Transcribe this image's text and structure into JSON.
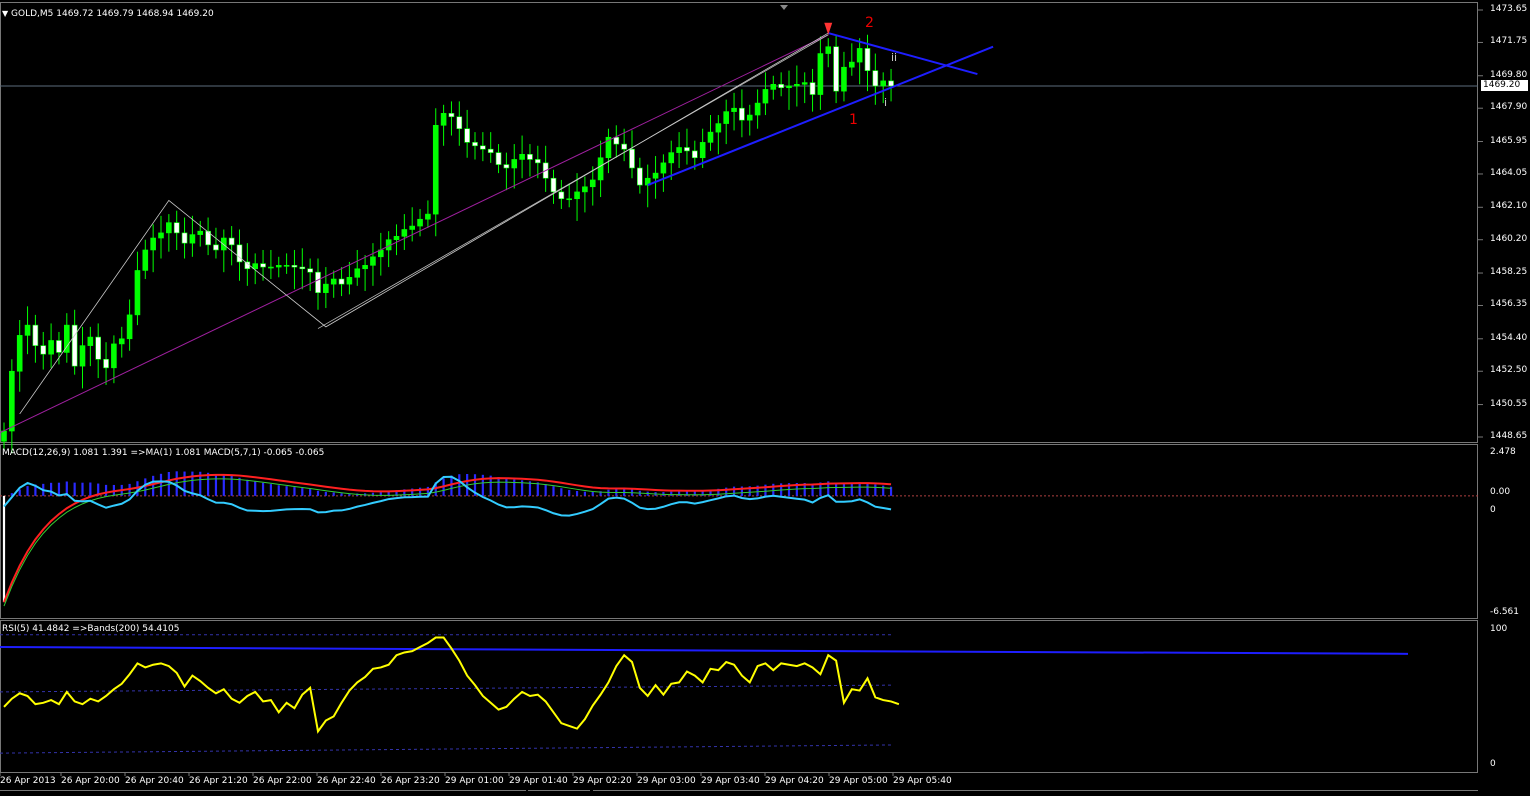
{
  "window": {
    "title": "GOLD,M5  1469.72 1469.79 1468.94 1469.20",
    "menu_arrow_icon": "triangle-down-icon"
  },
  "main_chart": {
    "current_price": "1469.20",
    "price_ticks": [
      "1473.65",
      "1471.75",
      "1469.80",
      "1467.90",
      "1465.95",
      "1464.05",
      "1462.10",
      "1460.20",
      "1458.25",
      "1456.35",
      "1454.40",
      "1452.50",
      "1450.55",
      "1448.65"
    ],
    "wave_labels": {
      "w1": "1",
      "w2": "2",
      "wi": "i",
      "wii": "ii"
    }
  },
  "macd": {
    "title": "MACD(12,26,9) 1.081 1.391  =>MA(1) 1.081  MACD(5,7,1) -0.065 -0.065",
    "ticks": {
      "top": "2.478",
      "zero_left": "0.00",
      "zero_right": "0",
      "bottom": "-6.561"
    }
  },
  "rsi": {
    "title": "RSI(5) 41.4842  =>Bands(200) 54.4105",
    "ticks": {
      "top": "100",
      "bottom": "0"
    }
  },
  "time_axis": [
    "26 Apr 2013",
    "26 Apr 20:00",
    "26 Apr 20:40",
    "26 Apr 21:20",
    "26 Apr 22:00",
    "26 Apr 22:40",
    "26 Apr 23:20",
    "29 Apr 01:00",
    "29 Apr 01:40",
    "29 Apr 02:20",
    "29 Apr 03:00",
    "29 Apr 03:40",
    "29 Apr 04:20",
    "29 Apr 05:00",
    "29 Apr 05:40"
  ],
  "colors": {
    "bull_candle": "#00ff00",
    "bear_candle": "#ffffff",
    "trendline": "#1e1eff",
    "channel_magenta": "#a020a0",
    "macd_signal": "#ff2020",
    "macd_fast": "#33ccff",
    "rsi_line": "#ffff00",
    "wave_label": "#ee1111"
  },
  "chart_data": {
    "type": "candlestick",
    "symbol": "GOLD",
    "timeframe": "M5",
    "ylim": [
      1448.65,
      1473.65
    ],
    "closes": [
      1449.0,
      1452.5,
      1454.6,
      1455.2,
      1454.0,
      1453.5,
      1454.3,
      1453.6,
      1455.2,
      1452.8,
      1454.0,
      1454.5,
      1453.2,
      1452.7,
      1454.1,
      1454.4,
      1455.8,
      1458.4,
      1459.6,
      1460.3,
      1460.6,
      1461.2,
      1460.6,
      1460.0,
      1460.5,
      1460.7,
      1459.9,
      1459.6,
      1460.3,
      1459.9,
      1458.9,
      1458.5,
      1458.8,
      1458.6,
      1458.6,
      1458.7,
      1458.7,
      1458.6,
      1458.5,
      1458.3,
      1457.1,
      1457.6,
      1457.9,
      1457.6,
      1458.0,
      1458.5,
      1458.7,
      1459.2,
      1459.6,
      1460.2,
      1460.4,
      1460.8,
      1461.0,
      1461.4,
      1461.7,
      1466.9,
      1467.6,
      1467.4,
      1466.7,
      1465.9,
      1465.7,
      1465.5,
      1465.3,
      1464.6,
      1464.4,
      1464.9,
      1465.2,
      1464.9,
      1464.7,
      1463.8,
      1463.0,
      1462.6,
      1462.6,
      1463.0,
      1463.3,
      1463.7,
      1465.0,
      1466.2,
      1465.8,
      1465.5,
      1464.4,
      1463.4,
      1463.8,
      1464.1,
      1464.7,
      1465.3,
      1465.6,
      1465.4,
      1465.0,
      1465.9,
      1466.5,
      1467.0,
      1467.7,
      1467.9,
      1467.2,
      1467.5,
      1468.2,
      1469.0,
      1469.3,
      1469.1,
      1469.2,
      1469.3,
      1469.4,
      1468.7,
      1471.1,
      1471.5,
      1468.9,
      1470.3,
      1470.6,
      1471.4,
      1470.1,
      1469.2,
      1469.5,
      1469.2
    ]
  },
  "rsi_data": {
    "values": [
      42,
      48,
      52,
      50,
      44,
      45,
      47,
      44,
      53,
      46,
      44,
      48,
      46,
      50,
      55,
      59,
      66,
      74,
      71,
      73,
      74,
      72,
      67,
      57,
      65,
      61,
      56,
      52,
      55,
      48,
      45,
      50,
      53,
      46,
      47,
      38,
      45,
      41,
      51,
      56,
      24,
      32,
      35,
      45,
      54,
      60,
      64,
      70,
      71,
      73,
      80,
      82,
      83,
      86,
      89,
      93,
      93,
      85,
      76,
      65,
      58,
      50,
      45,
      40,
      42,
      48,
      53,
      50,
      51,
      46,
      38,
      30,
      28,
      26,
      33,
      43,
      51,
      60,
      72,
      80,
      75,
      56,
      50,
      58,
      51,
      59,
      60,
      68,
      65,
      60,
      70,
      69,
      75,
      73,
      65,
      60,
      72,
      74,
      69,
      74,
      73,
      72,
      74,
      71,
      66,
      80,
      76,
      45,
      55,
      54,
      63,
      49,
      47,
      46,
      44
    ],
    "upper_band": 95,
    "mid_band": 58,
    "lower_band": 14
  }
}
